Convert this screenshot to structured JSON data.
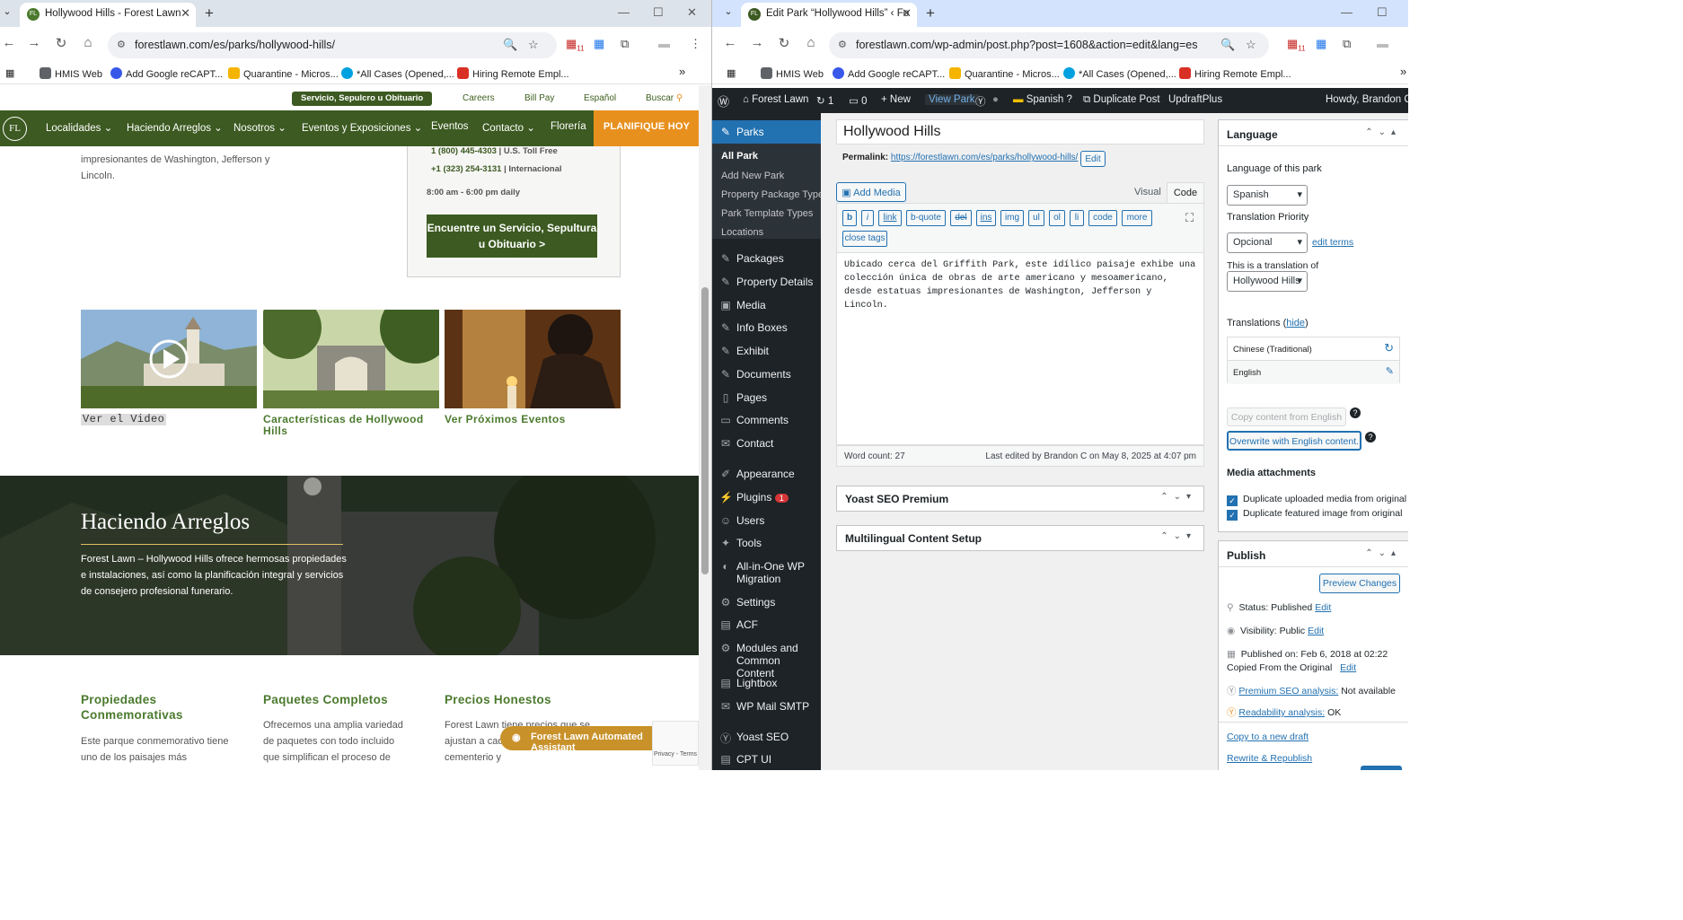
{
  "left": {
    "tab": {
      "title": "Hollywood Hills - Forest Lawn"
    },
    "url": "forestlawn.com/es/parks/hollywood-hills/",
    "ext_badge": "11",
    "bookmarks": [
      "HMIS Web",
      "Add Google reCAPT...",
      "Quarantine - Micros...",
      "*All Cases (Opened,...",
      "Hiring Remote Empl..."
    ],
    "top_links": {
      "pill": "Servicio, Sepulcro u Obituario",
      "careers": "Careers",
      "bill": "Bill Pay",
      "lang": "Español",
      "search": "Buscar"
    },
    "nav": {
      "logo": "FL",
      "items": [
        "Localidades",
        "Haciendo Arreglos",
        "Nosotros",
        "Eventos y Exposiciones",
        "Eventos",
        "Contacto",
        "Florería"
      ],
      "cta": "PLANIFIQUE HOY"
    },
    "intro_lines": [
      "impresionantes de Washington, Jefferson y",
      "Lincoln."
    ],
    "contact": {
      "phone1": "1 (800) 445-4303",
      "phone1_label": "| U.S. Toll Free",
      "phone2": "+1 (323) 254-3131",
      "phone2_label": "| Internacional",
      "hours": "8:00 am - 6:00 pm daily",
      "button": "Encuentre un Servicio, Sepultura u Obituario >"
    },
    "cards": [
      "Ver el Video",
      "Características de Hollywood Hills",
      "Ver Próximos Eventos"
    ],
    "hero": {
      "title": "Haciendo Arreglos",
      "text": "Forest Lawn – Hollywood Hills ofrece hermosas propiedades e instalaciones, así como la planificación integral y servicios de consejero profesional funerario."
    },
    "columns": [
      {
        "title": "Propiedades Conmemorativas",
        "text": "Este parque conmemorativo tiene uno de los paisajes más"
      },
      {
        "title": "Paquetes Completos",
        "text": "Ofrecemos una amplia variedad de paquetes con todo incluido que simplifican el proceso de"
      },
      {
        "title": "Precios Honestos",
        "text": "Forest Lawn tiene precios que se ajustan a cada ... propiedades de cementerio y"
      }
    ],
    "assistant": "Forest Lawn Automated Assistant",
    "recaptcha": "Privacy - Terms"
  },
  "right": {
    "tab": {
      "title": "Edit Park “Hollywood Hills” ‹ Fo"
    },
    "url": "forestlawn.com/wp-admin/post.php?post=1608&action=edit&lang=es",
    "ext_badge": "11",
    "bookmarks": [
      "HMIS Web",
      "Add Google reCAPT...",
      "Quarantine - Micros...",
      "*All Cases (Opened,...",
      "Hiring Remote Empl..."
    ],
    "adminbar": {
      "site": "Forest Lawn",
      "updates": "1",
      "comments": "0",
      "new": "New",
      "view": "View Park",
      "lang": "Spanish",
      "duplicate": "Duplicate Post",
      "updraft": "UpdraftPlus",
      "howdy": "Howdy, Brandon C"
    },
    "menu": {
      "active": "Parks",
      "sub": [
        "All Park",
        "Add New Park",
        "Property Package Types",
        "Park Template Types",
        "Locations"
      ],
      "items": [
        "Packages",
        "Property Details",
        "Media",
        "Info Boxes",
        "Exhibit",
        "Documents",
        "Pages",
        "Comments",
        "Contact",
        "Appearance",
        "Plugins",
        "Users",
        "Tools",
        "All-in-One WP Migration",
        "Settings",
        "ACF",
        "Modules and Common Content",
        "Lightbox",
        "WP Mail SMTP",
        "Yoast SEO",
        "CPT UI"
      ],
      "plugins_badge": "1"
    },
    "post": {
      "title": "Hollywood Hills",
      "permalink_label": "Permalink:",
      "permalink": "https://forestlawn.com/es/parks/hollywood-hills/",
      "edit": "Edit",
      "add_media": "Add Media",
      "tab_visual": "Visual",
      "tab_code": "Code",
      "quicktags": [
        "b",
        "i",
        "link",
        "b-quote",
        "del",
        "ins",
        "img",
        "ul",
        "ol",
        "li",
        "code",
        "more"
      ],
      "close_tags": "close tags",
      "content": "Ubicado cerca del Griffith Park, este idílico paisaje exhibe una colección única de obras de arte americano y mesoamericano, desde estatuas impresionantes de Washington, Jefferson y Lincoln.",
      "word_count": "Word count: 27",
      "last_edited": "Last edited by Brandon C on May 8, 2025 at 4:07 pm",
      "yoast": "Yoast SEO Premium",
      "multilingual": "Multilingual Content Setup"
    },
    "language": {
      "title": "Language",
      "of_park": "Language of this park",
      "lang_value": "Spanish",
      "priority_label": "Translation Priority",
      "priority_value": "Opcional",
      "edit_terms": "edit terms",
      "translation_of": "This is a translation of",
      "translation_value": "Hollywood Hills",
      "translations": "Translations",
      "hide": "hide",
      "langs": [
        "Chinese (Traditional)",
        "English"
      ],
      "copy_btn": "Copy content from English",
      "overwrite_btn": "Overwrite with English content.",
      "media_title": "Media attachments",
      "dup_media": "Duplicate uploaded media from original",
      "dup_featured": "Duplicate featured image from original"
    },
    "publish": {
      "title": "Publish",
      "preview": "Preview Changes",
      "status": "Status: Published",
      "status_edit": "Edit",
      "visibility": "Visibility: Public",
      "visibility_edit": "Edit",
      "published": "Published on: Feb 6, 2018 at 02:22",
      "copied": "Copied From the Original",
      "copied_edit": "Edit",
      "seo_label": "Premium SEO analysis:",
      "seo_value": "Not available",
      "read_label": "Readability analysis:",
      "read_value": "OK",
      "copy_draft": "Copy to a new draft",
      "rewrite": "Rewrite & Republish"
    }
  }
}
